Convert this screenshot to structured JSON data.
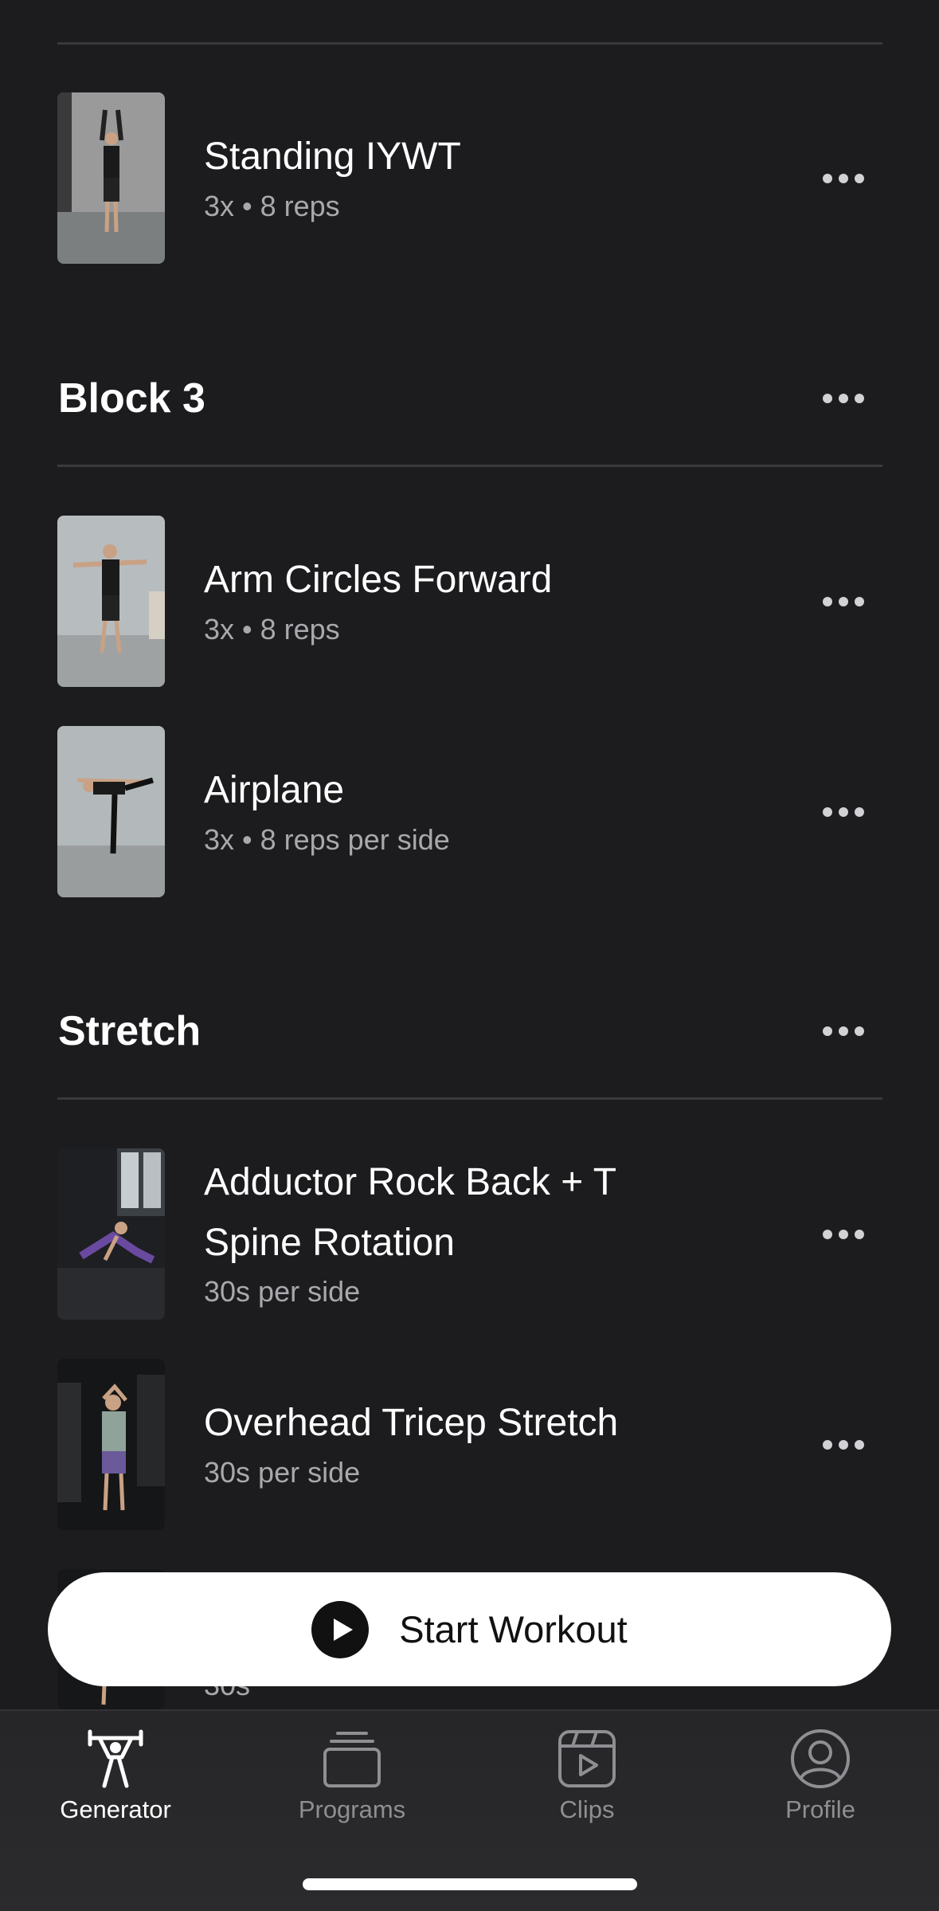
{
  "sections": [
    {
      "title": "Block 3"
    },
    {
      "title": "Stretch"
    }
  ],
  "exercises": [
    {
      "name": "Standing IYWT",
      "detail": "3x • 8 reps"
    },
    {
      "name": "Arm Circles Forward",
      "detail": "3x • 8 reps"
    },
    {
      "name": "Airplane",
      "detail": "3x • 8 reps per side"
    },
    {
      "name_line1": "Adductor Rock Back + T",
      "name_line2": "Spine Rotation",
      "detail": "30s per side"
    },
    {
      "name": "Overhead Tricep Stretch",
      "detail": "30s per side"
    },
    {
      "detail": "30s"
    }
  ],
  "start_button": {
    "label": "Start Workout"
  },
  "tabs": [
    {
      "label": "Generator",
      "icon": "generator-icon",
      "active": true
    },
    {
      "label": "Programs",
      "icon": "programs-icon",
      "active": false
    },
    {
      "label": "Clips",
      "icon": "clips-icon",
      "active": false
    },
    {
      "label": "Profile",
      "icon": "profile-icon",
      "active": false
    }
  ],
  "colors": {
    "background": "#1c1c1e",
    "accent": "#ffffff",
    "muted": "#8e8e93"
  }
}
